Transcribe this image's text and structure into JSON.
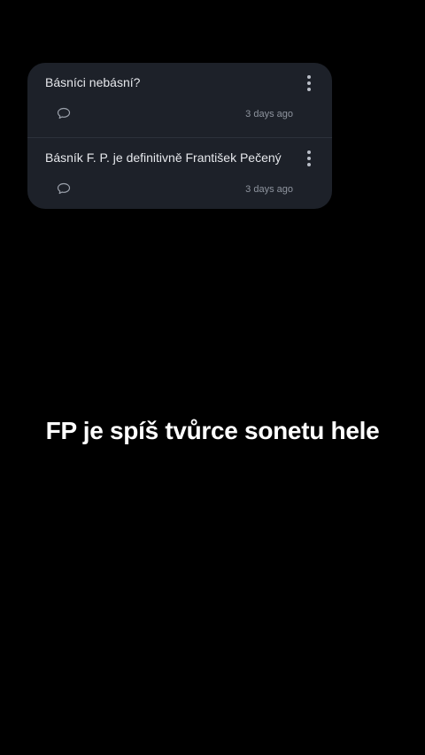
{
  "comments": [
    {
      "text": "Básníci nebásní?",
      "timestamp": "3 days ago",
      "reply_icon": "speech-bubble-icon",
      "menu_icon": "more-vertical-icon"
    },
    {
      "text": "Básník F. P. je definitivně František Pečený",
      "timestamp": "3 days ago",
      "reply_icon": "speech-bubble-icon",
      "menu_icon": "more-vertical-icon"
    }
  ],
  "caption": "FP je spíš tvůrce sonetu hele",
  "colors": {
    "background": "#000000",
    "card": "#1d2129",
    "text": "#e6e8ec",
    "muted": "#8e949e",
    "caption_text": "#ffffff"
  }
}
